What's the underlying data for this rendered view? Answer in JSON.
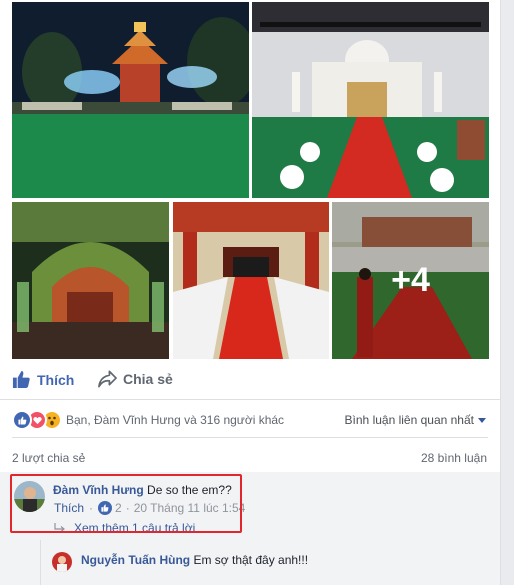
{
  "photos": {
    "more_count": "+4"
  },
  "actions": {
    "like_label": "Thích",
    "share_label": "Chia sẻ"
  },
  "reactions": {
    "summary": "Bạn, Đàm Vĩnh Hưng và 316 người khác",
    "icons": [
      "like-icon",
      "love-icon",
      "wow-icon"
    ],
    "colors": {
      "like": "#4267b2",
      "love": "#f25268",
      "wow": "#f7b125"
    }
  },
  "sort": {
    "label": "Bình luận liên quan nhất"
  },
  "stats": {
    "shares": "2 lượt chia sẻ",
    "comments": "28 bình luận"
  },
  "comments": [
    {
      "author": "Đàm Vĩnh Hưng",
      "text": "De so the em??",
      "like_label": "Thích",
      "like_count": "2",
      "timestamp": "20 Tháng 11 lúc 1:54",
      "replies_link": "Xem thêm 1 câu trả lời"
    },
    {
      "author": "Nguyễn Tuấn Hùng",
      "text": "Em sợ thật đây anh!!!"
    }
  ],
  "colors": {
    "accent": "#4267b2",
    "link": "#385898",
    "highlight_border": "#e3262e"
  }
}
